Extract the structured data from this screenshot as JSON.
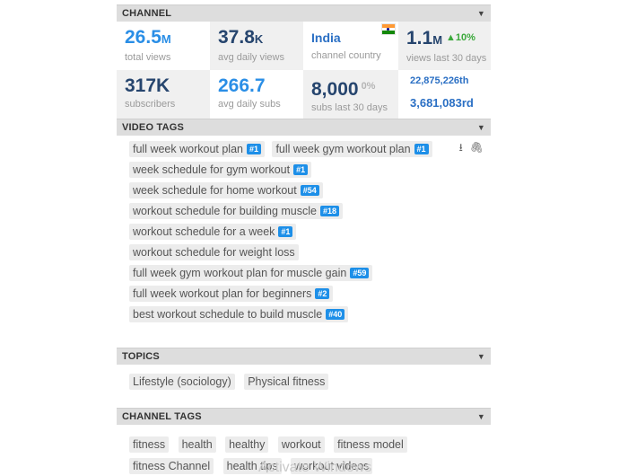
{
  "channel": {
    "header": "CHANNEL",
    "total_views": {
      "value": "26.5",
      "unit": "M",
      "label": "total views"
    },
    "avg_daily_views": {
      "value": "37.8",
      "unit": "K",
      "label": "avg daily views"
    },
    "country": {
      "value": "India",
      "label": "channel country",
      "flag": "india-flag-icon"
    },
    "views_30": {
      "value": "1.1",
      "unit": "M",
      "change": "▲10%",
      "label": "views last 30 days"
    },
    "subscribers": {
      "value": "317K",
      "label": "subscribers"
    },
    "avg_daily_subs": {
      "value": "266.7",
      "label": "avg daily subs"
    },
    "subs_30": {
      "value": "8,000",
      "change": "0%",
      "label": "subs last 30 days"
    },
    "rank_views": "22,875,226th",
    "rank_subs": "3,681,083rd",
    "cut_label_1": "s",
    "cut_label_2": "ra",
    "cut_label_3": "vi"
  },
  "video_tags": {
    "header": "VIDEO TAGS",
    "tags": [
      {
        "text": "full week workout plan",
        "rank": "#1"
      },
      {
        "text": "full week gym workout plan",
        "rank": "#1"
      },
      {
        "text": "week schedule for gym workout",
        "rank": "#1"
      },
      {
        "text": "week schedule for home workout",
        "rank": "#54"
      },
      {
        "text": "workout schedule for building muscle",
        "rank": "#18"
      },
      {
        "text": "workout schedule for a week",
        "rank": "#1"
      },
      {
        "text": "workout schedule for weight loss",
        "rank": ""
      },
      {
        "text": "full week gym workout plan for muscle gain",
        "rank": "#59"
      },
      {
        "text": "full week workout plan for beginners",
        "rank": "#2"
      },
      {
        "text": "best workout schedule to build muscle",
        "rank": "#40"
      }
    ]
  },
  "topics": {
    "header": "TOPICS",
    "items": [
      "Lifestyle (sociology)",
      "Physical fitness"
    ]
  },
  "channel_tags": {
    "header": "CHANNEL TAGS",
    "items": [
      "fitness",
      "health",
      "healthy",
      "workout",
      "fitness model",
      "fitness Channel",
      "health tips",
      "workout videos"
    ]
  },
  "watermark": "Activate Windows",
  "colors": {
    "accent_blue": "#2a8ee6",
    "navy": "#26456e",
    "tag_rank_bg": "#1d8fe8",
    "up_green": "#3aa83a"
  }
}
